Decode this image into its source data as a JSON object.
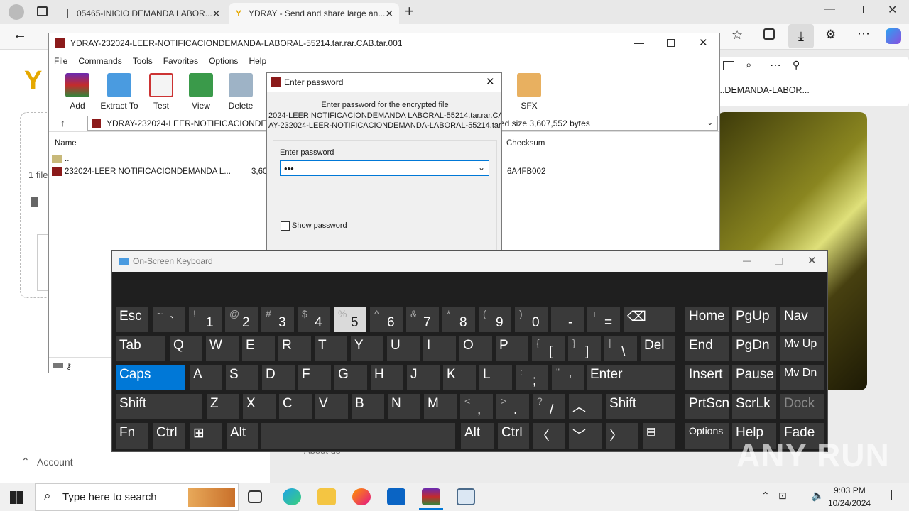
{
  "browser": {
    "tabs": [
      {
        "label": "05465-INICIO DEMANDA LABOR..."
      },
      {
        "label": "YDRAY - Send and share large an..."
      }
    ],
    "download_item": "...DEMANDA-LABOR...",
    "sidebar": {
      "file_count": "1 file",
      "account_label": "Account",
      "about_label": "About us"
    }
  },
  "winrar": {
    "title": "YDRAY-232024-LEER-NOTIFICACIONDEMANDA-LABORAL-55214.tar.rar.CAB.tar.001",
    "menu": [
      "File",
      "Commands",
      "Tools",
      "Favorites",
      "Options",
      "Help"
    ],
    "toolbar": [
      "Add",
      "Extract To",
      "Test",
      "View",
      "Delete",
      "SFX"
    ],
    "path": "YDRAY-232024-LEER-NOTIFICACIONDEMA",
    "path_info": "ed size 3,607,552 bytes",
    "columns": {
      "name": "Name",
      "checksum": "Checksum"
    },
    "rows": [
      {
        "name": "..",
        "size": "",
        "checksum": ""
      },
      {
        "name": "232024-LEER NOTIFICACIONDEMANDA L...",
        "size": "3,60",
        "checksum": "6A4FB002"
      }
    ]
  },
  "dialog": {
    "title": "Enter password",
    "prompt": "Enter password for the encrypted file",
    "file_line1": "2024-LEER NOTIFICACIONDEMANDA LABORAL-55214.tar.rar.CAB.t",
    "file_line2": "AY-232024-LEER-NOTIFICACIONDEMANDA-LABORAL-55214.tar.rar",
    "field_label": "Enter password",
    "field_value": "•••",
    "show_password": "Show password"
  },
  "osk": {
    "title": "On-Screen Keyboard",
    "keys": {
      "esc": "Esc",
      "tab": "Tab",
      "caps": "Caps",
      "shift": "Shift",
      "fn": "Fn",
      "ctrl": "Ctrl",
      "alt": "Alt",
      "del": "Del",
      "enter": "Enter",
      "home": "Home",
      "pgup": "PgUp",
      "nav": "Nav",
      "end": "End",
      "pgdn": "PgDn",
      "mvup": "Mv Up",
      "insert": "Insert",
      "pause": "Pause",
      "mvdn": "Mv Dn",
      "prtscn": "PrtScn",
      "scrlk": "ScrLk",
      "dock": "Dock",
      "options": "Options",
      "help": "Help",
      "fade": "Fade"
    },
    "row1": [
      [
        "~",
        "`"
      ],
      [
        "!",
        "1"
      ],
      [
        "@",
        "2"
      ],
      [
        "#",
        "3"
      ],
      [
        "$",
        "4"
      ],
      [
        "%",
        "5"
      ],
      [
        "^",
        "6"
      ],
      [
        "&",
        "7"
      ],
      [
        "*",
        "8"
      ],
      [
        "(",
        "9"
      ],
      [
        ")",
        "0"
      ],
      [
        "_",
        "-"
      ],
      [
        "+",
        "="
      ]
    ],
    "row2": [
      "Q",
      "W",
      "E",
      "R",
      "T",
      "Y",
      "U",
      "I",
      "O",
      "P"
    ],
    "row2p": [
      [
        "{",
        "["
      ],
      [
        "}",
        "]"
      ],
      [
        "|",
        "\\"
      ]
    ],
    "row3": [
      "A",
      "S",
      "D",
      "F",
      "G",
      "H",
      "J",
      "K",
      "L"
    ],
    "row3p": [
      [
        ":",
        ";"
      ],
      [
        "\"",
        "'"
      ]
    ],
    "row4": [
      "Z",
      "X",
      "C",
      "V",
      "B",
      "N",
      "M"
    ],
    "row4p": [
      [
        "<",
        ","
      ],
      [
        ">",
        "."
      ],
      [
        "?",
        "/"
      ]
    ]
  },
  "taskbar": {
    "search_placeholder": "Type here to search",
    "time": "9:03 PM",
    "date": "10/24/2024"
  },
  "watermark": "ANY RUN"
}
